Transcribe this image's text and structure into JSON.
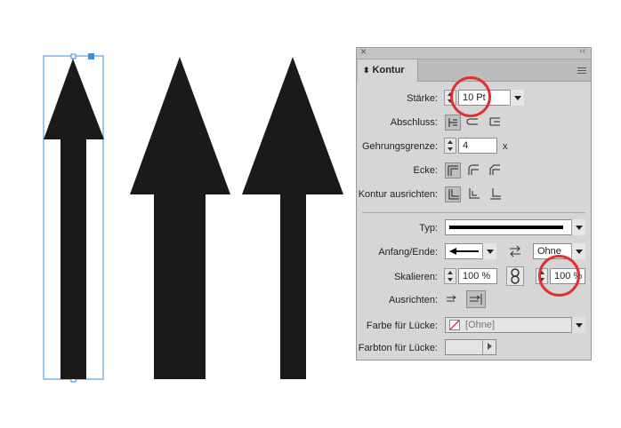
{
  "panel": {
    "close_glyph": "×",
    "collapse_glyph": "‹‹",
    "tab_label": "Kontur",
    "menu_icon": "panel-menu-icon"
  },
  "staerke": {
    "label": "Stärke:",
    "value": "10 Pt"
  },
  "abschluss": {
    "label": "Abschluss:"
  },
  "gehrung": {
    "label": "Gehrungsgrenze:",
    "value": "4",
    "suffix": "x"
  },
  "ecke": {
    "label": "Ecke:"
  },
  "ausrichten_kontur": {
    "label": "Kontur ausrichten:"
  },
  "typ": {
    "label": "Typ:"
  },
  "anfang_ende": {
    "label": "Anfang/Ende:",
    "end_value": "Ohne"
  },
  "skalieren": {
    "label": "Skalieren:",
    "start": "100 %",
    "end": "100 %"
  },
  "ausrichten": {
    "label": "Ausrichten:"
  },
  "farbe_luecke": {
    "label": "Farbe für Lücke:",
    "value": "[Ohne]"
  },
  "farbton_luecke": {
    "label": "Farbton für Lücke:",
    "value": ""
  },
  "colors": {
    "annotation": "#e03030",
    "selection": "#3a8de0",
    "arrow": "#1b1a19"
  }
}
